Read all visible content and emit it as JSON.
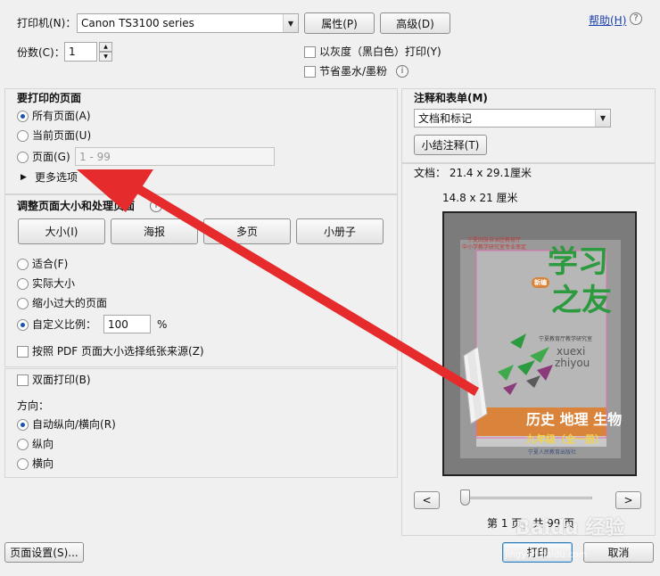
{
  "printer": {
    "label": "打印机(N)：",
    "selected": "Canon TS3100 series",
    "properties_btn": "属性(P)",
    "advanced_btn": "高级(D)"
  },
  "help": {
    "label": "帮助(H)",
    "icon": "help-icon"
  },
  "copies": {
    "label": "份数(C)：",
    "value": "1"
  },
  "options": {
    "grayscale": "以灰度（黑白色）打印(Y)",
    "save_ink": "节省墨水/墨粉"
  },
  "pages": {
    "title": "要打印的页面",
    "all": "所有页面(A)",
    "current": "当前页面(U)",
    "range": "页面(G)",
    "range_placeholder": "1 - 99",
    "more": "更多选项"
  },
  "sizing": {
    "title": "调整页面大小和处理页面",
    "tabs": [
      "大小(I)",
      "海报",
      "多页",
      "小册子"
    ],
    "fit": "适合(F)",
    "actual": "实际大小",
    "shrink": "缩小过大的页面",
    "custom": "自定义比例：",
    "scale": "100",
    "percent": "%",
    "pdf_source": "按照 PDF 页面大小选择纸张来源(Z)"
  },
  "duplex": {
    "label": "双面打印(B)",
    "orientation_label": "方向：",
    "auto": "自动纵向/横向(R)",
    "portrait": "纵向",
    "landscape": "横向"
  },
  "comments": {
    "title": "注释和表单(M)",
    "selected": "文档和标记",
    "summarize_btn": "小结注释(T)"
  },
  "preview": {
    "doc_size": "文档： 21.4 x 29.1厘米",
    "paper_size": "14.8 x 21 厘米",
    "page_info": "第 1 页，共 99 页",
    "prev": "<",
    "next": ">",
    "cover": {
      "org_line1": "宁夏回族自治区教育厅",
      "org_line2": "中小学教学研究室专业审定",
      "title1": "学习",
      "title2": "之友",
      "badge": "新编",
      "pinyin1": "xuexi",
      "pinyin2": "zhiyou",
      "publisher_small": "宁夏教育厅教学研究室",
      "subjects": "历史 地理 生物",
      "grade": "九年级（全一册）",
      "press": "宁夏人民教育出版社"
    }
  },
  "bottom": {
    "page_setup": "页面设置(S)...",
    "print": "打印",
    "cancel": "取消"
  },
  "watermark": {
    "text": "Baidu 经验",
    "sub": "jingyan.baidu.com"
  },
  "colors": {
    "arrow": "#e52b2b",
    "green": "#2c9a3e",
    "orange": "#d9843a",
    "accent": "#1a54b0"
  }
}
